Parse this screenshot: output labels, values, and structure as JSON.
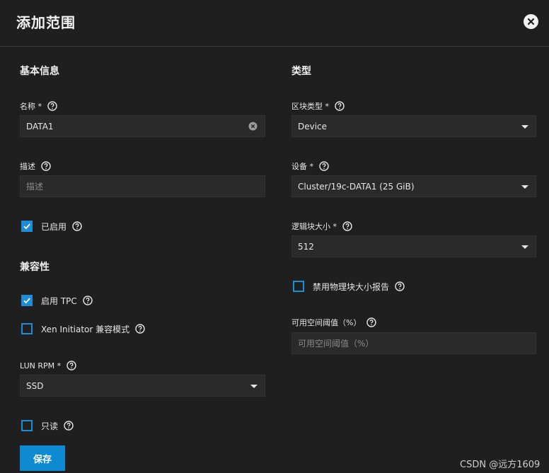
{
  "dialog": {
    "title": "添加范围",
    "close_icon": "close-circle-icon"
  },
  "basic": {
    "section_title": "基本信息",
    "name": {
      "label": "名称 *",
      "value": "DATA1"
    },
    "description": {
      "label": "描述",
      "placeholder": "描述",
      "value": ""
    },
    "enabled": {
      "label": "已启用",
      "checked": true
    }
  },
  "compat": {
    "section_title": "兼容性",
    "tpc": {
      "label": "启用 TPC",
      "checked": true
    },
    "xen": {
      "label": "Xen Initiator 兼容模式",
      "checked": false
    },
    "lun_rpm": {
      "label": "LUN RPM *",
      "value": "SSD"
    },
    "readonly": {
      "label": "只读",
      "checked": false
    }
  },
  "type": {
    "section_title": "类型",
    "extent_type": {
      "label": "区块类型 *",
      "value": "Device"
    },
    "device": {
      "label": "设备 *",
      "value": "Cluster/19c-DATA1 (25 GiB)"
    },
    "logical_block_size": {
      "label": "逻辑块大小 *",
      "value": "512"
    },
    "disable_physical_block": {
      "label": "禁用物理块大小报告",
      "checked": false
    },
    "available_space_threshold": {
      "label": "可用空间阈值（%）",
      "placeholder": "可用空间阈值（%）",
      "value": ""
    }
  },
  "actions": {
    "save_label": "保存"
  },
  "watermark": "CSDN @远方1609",
  "colors": {
    "accent": "#0d8ad1",
    "background": "#1f1f1f",
    "field": "#2a2a2a"
  }
}
